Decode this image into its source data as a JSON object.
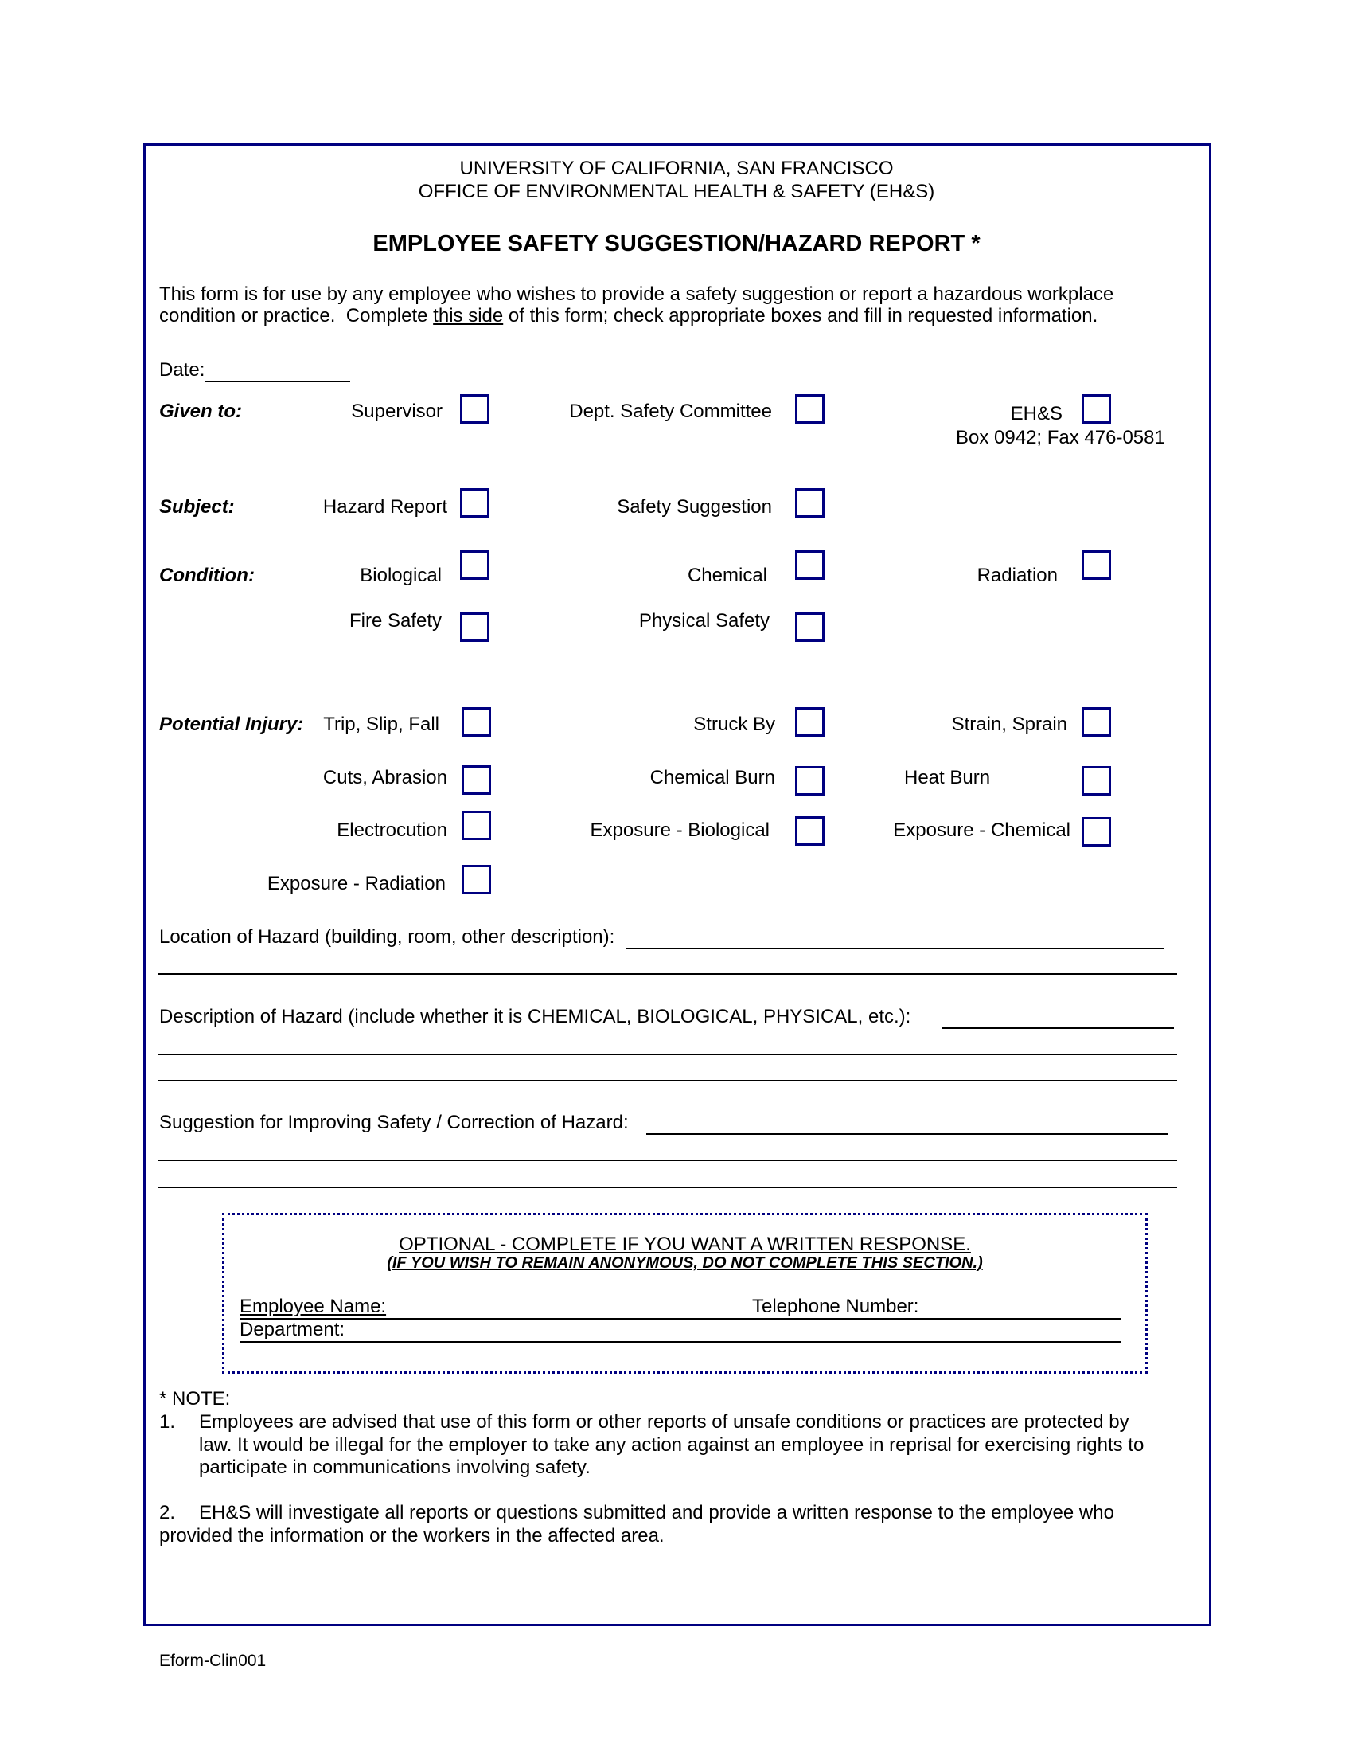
{
  "header": {
    "institution": "UNIVERSITY OF CALIFORNIA, SAN FRANCISCO",
    "office": "OFFICE OF ENVIRONMENTAL HEALTH & SAFETY (EH&S)",
    "title": "EMPLOYEE SAFETY SUGGESTION/HAZARD REPORT *"
  },
  "intro": {
    "line1": "This form is for use by any employee who wishes to provide a safety suggestion or report a hazardous workplace",
    "line2_before": "condition or practice.  Complete ",
    "line2_underlined": "this side",
    "line2_after": " of this form; check appropriate boxes and fill in requested information."
  },
  "date": {
    "label": "Date:",
    "value": ""
  },
  "given_to": {
    "label": "Given to:",
    "options": [
      {
        "label": "Supervisor",
        "checked": false
      },
      {
        "label": "Dept. Safety Committee",
        "checked": false
      },
      {
        "label": "EH&S",
        "checked": false
      }
    ],
    "ehs_contact": "Box 0942;  Fax 476-0581"
  },
  "subject": {
    "label": "Subject:",
    "options": [
      {
        "label": "Hazard Report",
        "checked": false
      },
      {
        "label": "Safety Suggestion",
        "checked": false
      }
    ]
  },
  "condition": {
    "label": "Condition:",
    "options": [
      {
        "label": "Biological",
        "checked": false
      },
      {
        "label": "Chemical",
        "checked": false
      },
      {
        "label": "Radiation",
        "checked": false
      },
      {
        "label": "Fire Safety",
        "checked": false
      },
      {
        "label": "Physical Safety",
        "checked": false
      }
    ]
  },
  "potential_injury": {
    "label": "Potential Injury:",
    "options": [
      {
        "label": "Trip, Slip, Fall",
        "checked": false
      },
      {
        "label": "Struck By",
        "checked": false
      },
      {
        "label": "Strain, Sprain",
        "checked": false
      },
      {
        "label": "Cuts, Abrasion",
        "checked": false
      },
      {
        "label": "Chemical Burn",
        "checked": false
      },
      {
        "label": "Heat Burn",
        "checked": false
      },
      {
        "label": "Electrocution",
        "checked": false
      },
      {
        "label": "Exposure - Biological",
        "checked": false
      },
      {
        "label": "Exposure - Chemical",
        "checked": false
      },
      {
        "label": "Exposure - Radiation",
        "checked": false
      }
    ]
  },
  "hazard": {
    "location_label": "Location of Hazard (building, room, other description):",
    "description_label": "Description of Hazard (include whether it is CHEMICAL, BIOLOGICAL, PHYSICAL, etc.):",
    "suggestion_label": "Suggestion for Improving Safety / Correction of Hazard:",
    "location_value": "",
    "description_value": "",
    "suggestion_value": ""
  },
  "optional": {
    "heading": "OPTIONAL - COMPLETE IF YOU WANT A WRITTEN RESPONSE.",
    "subheading": "(IF YOU WISH TO REMAIN ANONYMOUS, DO NOT COMPLETE THIS SECTION.)",
    "employee_name_label": "Employee Name:",
    "employee_name_value": "",
    "telephone_label": "Telephone Number:",
    "telephone_value": "",
    "department_label": "Department:",
    "department_value": ""
  },
  "notes": {
    "heading": "* NOTE:",
    "item1_num": "1.",
    "item1_line1": "Employees are advised that use of this form or other reports of unsafe conditions or practices are protected by",
    "item1_line2": "law. It would be illegal for the employer to take any action against an employee in reprisal for exercising rights to",
    "item1_line3": "participate in communications involving safety.",
    "item2_num": "2.",
    "item2_line1": "EH&S will investigate all reports or questions submitted and provide a written response to the employee who",
    "item2_line2": "provided the information or the workers in the affected area."
  },
  "footer": {
    "form_id": "Eform-Clin001"
  },
  "colors": {
    "border": "#000080",
    "text": "#000000"
  }
}
